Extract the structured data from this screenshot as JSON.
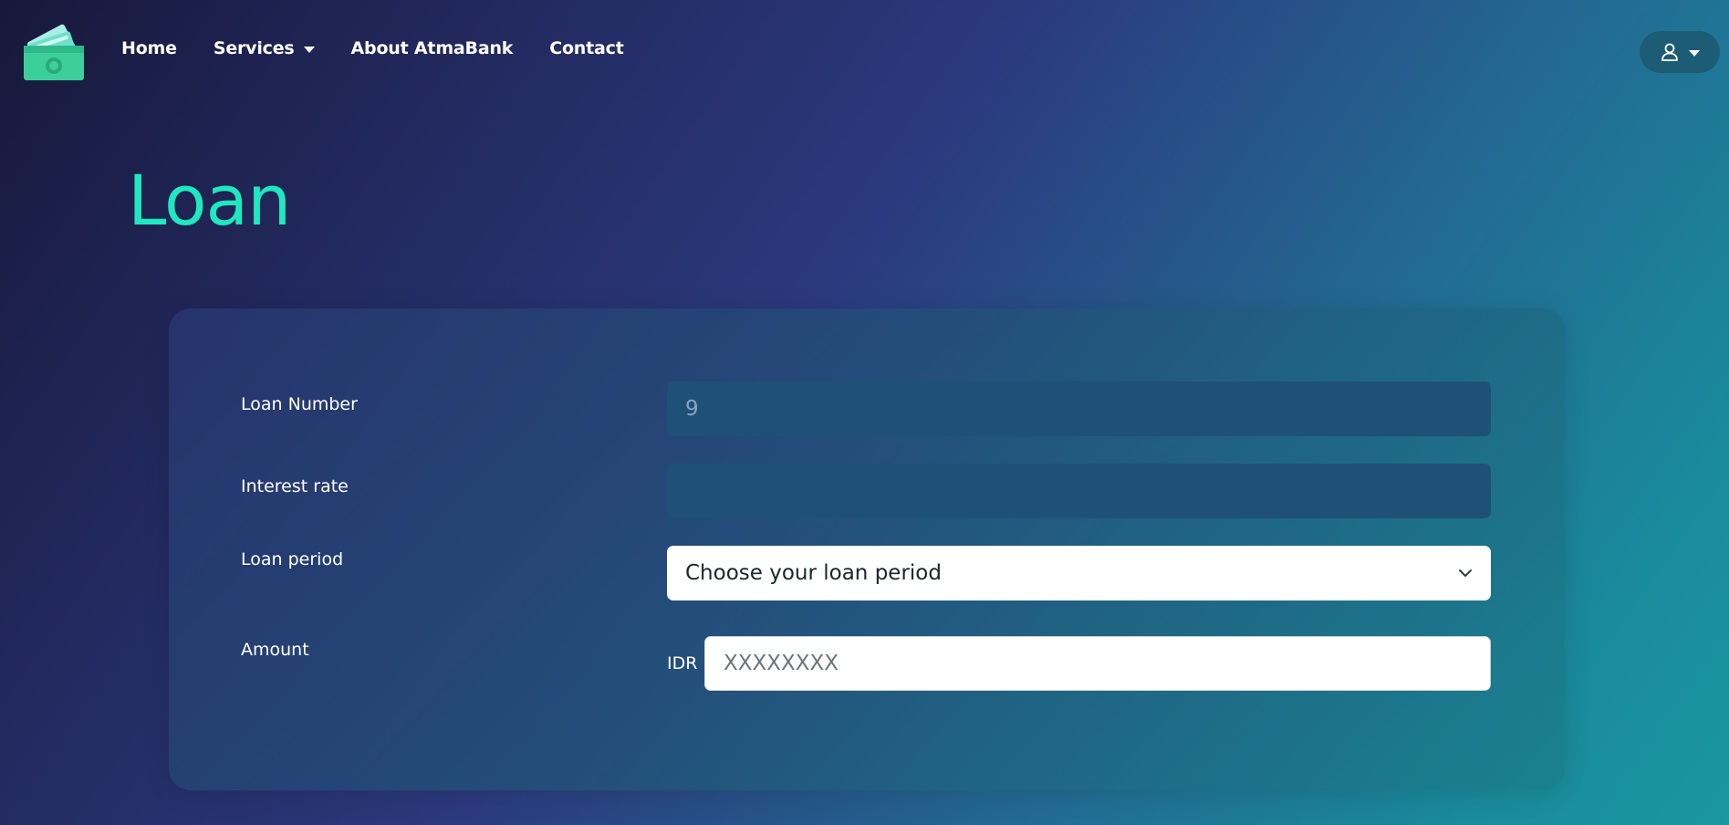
{
  "nav": {
    "logo_icon": "money-wallet-icon",
    "links": [
      {
        "label": "Home"
      },
      {
        "label": "Services",
        "has_dropdown": true
      },
      {
        "label": "About AtmaBank"
      },
      {
        "label": "Contact"
      }
    ],
    "user_icon": "user-icon"
  },
  "page": {
    "title": "Loan"
  },
  "form": {
    "loan_number": {
      "label": "Loan Number",
      "placeholder": "9",
      "value": ""
    },
    "interest_rate": {
      "label": "Interest rate",
      "value": ""
    },
    "loan_period": {
      "label": "Loan period",
      "selected": "Choose your loan period"
    },
    "amount": {
      "label": "Amount",
      "prefix": "IDR",
      "placeholder": "XXXXXXXX"
    }
  },
  "colors": {
    "accent": "#1fe8c0",
    "dark_input": "#1f5177"
  }
}
